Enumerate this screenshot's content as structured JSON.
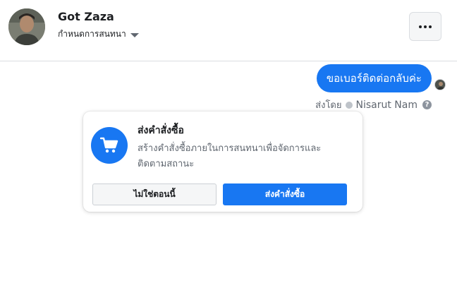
{
  "header": {
    "contact_name": "Got Zaza",
    "manage_conversation_label": "กำหนดการสนทนา",
    "more_button_icon": "more-dots-icon"
  },
  "message": {
    "text": "ขอเบอร์ติดต่อกลับค่ะ",
    "sent_by_label": "ส่งโดย",
    "sender_name": "Nisarut Nam",
    "help_glyph": "?"
  },
  "order_card": {
    "icon": "cart-icon",
    "title": "ส่งคำสั่งซื้อ",
    "description": "สร้างคำสั่งซื้อภายในการสนทนาเพื่อจัดการและติดตามสถานะ",
    "not_now_label": "ไม่ใช่ตอนนี้",
    "send_order_label": "ส่งคำสั่งซื้อ"
  },
  "colors": {
    "accent": "#1877f2",
    "text_secondary": "#606770",
    "border": "#dadde1"
  }
}
